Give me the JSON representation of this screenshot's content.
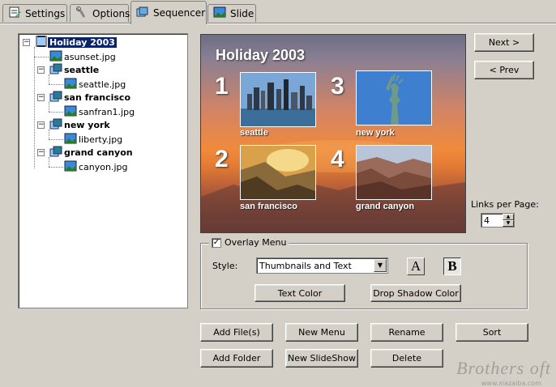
{
  "tabs": [
    {
      "label": "Settings",
      "icon": "settings-icon"
    },
    {
      "label": "Options",
      "icon": "options-icon"
    },
    {
      "label": "Sequencer",
      "icon": "sequencer-icon",
      "active": true
    },
    {
      "label": "Slide",
      "icon": "slide-icon"
    }
  ],
  "tree": {
    "root": "Holiday 2003",
    "items": [
      {
        "label": "asunset.jpg"
      },
      {
        "label": "seattle",
        "file": "seattle.jpg"
      },
      {
        "label": "san francisco",
        "file": "sanfran1.jpg"
      },
      {
        "label": "new york",
        "file": "liberty.jpg"
      },
      {
        "label": "grand canyon",
        "file": "canyon.jpg"
      }
    ]
  },
  "preview": {
    "title": "Holiday 2003",
    "slots": [
      {
        "number": "1",
        "caption": "seattle"
      },
      {
        "number": "2",
        "caption": "san francisco"
      },
      {
        "number": "3",
        "caption": "new york"
      },
      {
        "number": "4",
        "caption": "grand canyon"
      }
    ]
  },
  "nav": {
    "next": "Next >",
    "prev": "< Prev"
  },
  "links_per_page": {
    "label": "Links per Page:",
    "value": "4"
  },
  "overlay": {
    "legend": "Overlay Menu",
    "checked": true,
    "style_label": "Style:",
    "style_value": "Thumbnails and Text",
    "font_a": "A",
    "font_b": "B",
    "text_color": "Text Color",
    "shadow_color": "Drop Shadow Color"
  },
  "actions": {
    "add_files": "Add File(s)",
    "new_menu": "New Menu",
    "rename": "Rename",
    "sort": "Sort",
    "add_folder": "Add Folder",
    "new_slideshow": "New SlideShow",
    "delete": "Delete"
  },
  "watermark": {
    "text": "Brothers oft",
    "sub": "www.xiazaiba.com"
  },
  "colors": {
    "face": "#d4d0c8",
    "selection": "#0a246a"
  }
}
